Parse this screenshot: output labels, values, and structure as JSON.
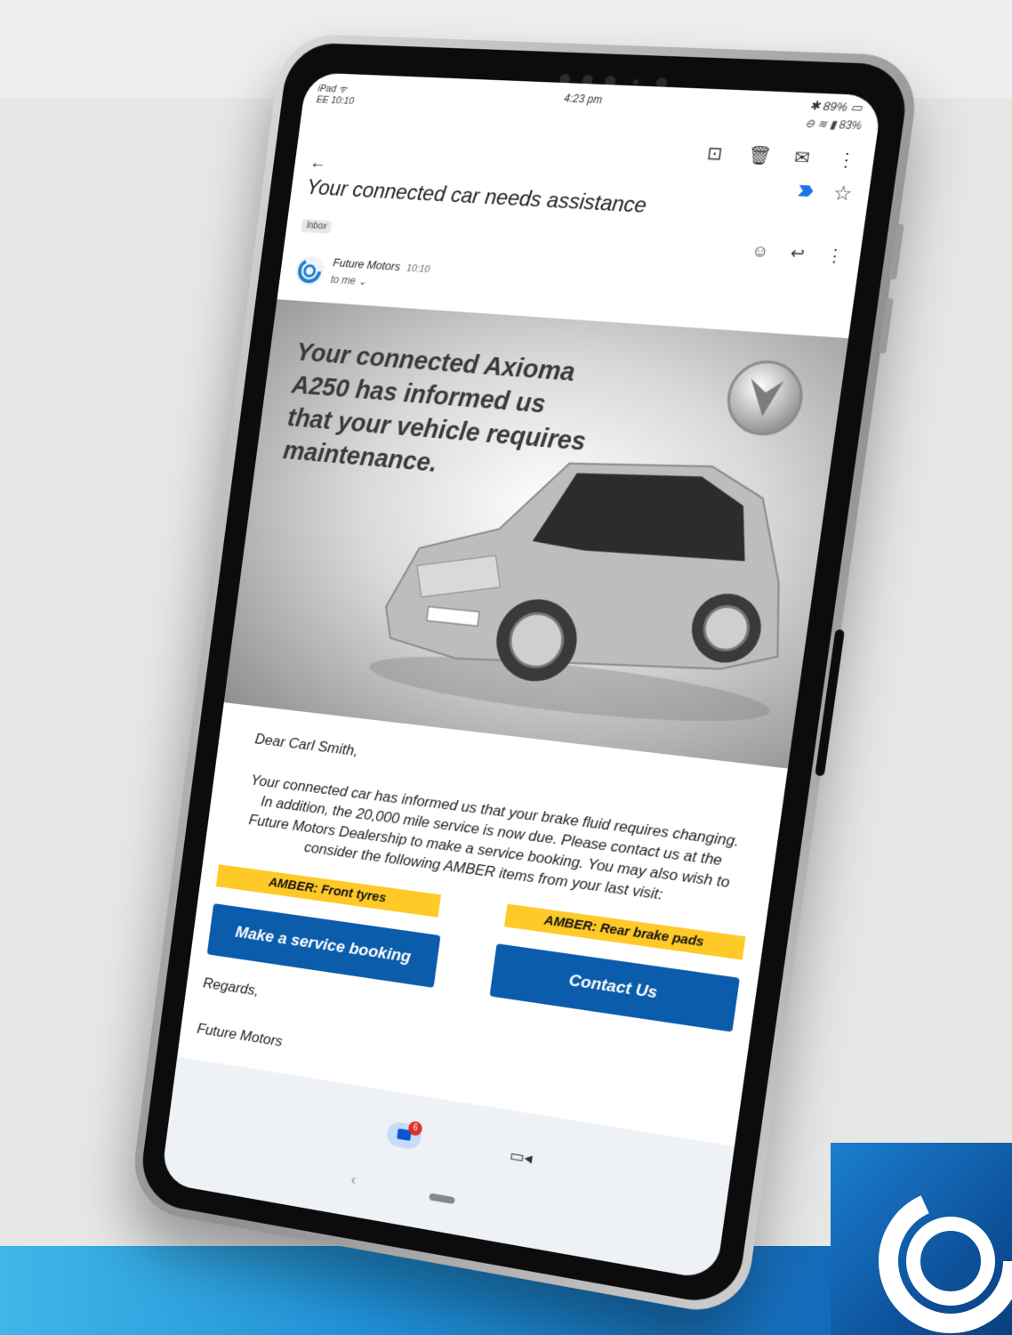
{
  "status": {
    "left": "iPad ᯤ",
    "carrier_time": "EE 10:10",
    "center_time": "4:23 pm",
    "right_top": "89%",
    "right_bottom": "83%"
  },
  "email": {
    "subject": "Your connected car needs assistance",
    "label": "Inbox",
    "sender": "Future Motors",
    "time": "10:10",
    "to": "to me ⌄"
  },
  "hero": {
    "headline": "Your connected Axioma A250 has informed us that your vehicle requires maintenance."
  },
  "body": {
    "greeting": "Dear Carl Smith,",
    "paragraph": "Your connected car has informed us that your brake fluid requires changing. In addition, the 20,000 mile service is now due. Please contact us at the Future Motors Dealership to make a service booking. You may also wish to consider the following AMBER items from your last visit:",
    "amber_left": "AMBER: Front tyres",
    "amber_right": "AMBER: Rear brake pads",
    "button_booking": "Make a service booking",
    "button_contact": "Contact Us",
    "regards": "Regards,",
    "signoff": "Future Motors"
  },
  "nav": {
    "mail_badge": "6"
  },
  "colors": {
    "amber": "#ffc928",
    "button_blue": "#0b5cab",
    "brand_gradient_start": "#3fb6e8",
    "brand_gradient_end": "#1468b8"
  },
  "icons": {
    "toolbar": [
      "archive-icon",
      "delete-icon",
      "mark-unread-icon",
      "more-vert-icon"
    ],
    "message": [
      "emoji-icon",
      "reply-icon",
      "more-vert-icon"
    ]
  }
}
